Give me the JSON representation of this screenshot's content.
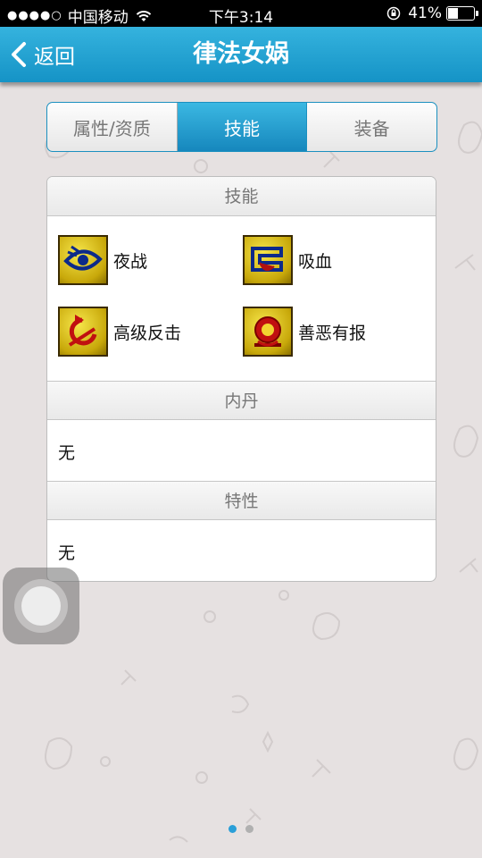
{
  "status_bar": {
    "signal": "●●●●○",
    "carrier": "中国移动",
    "time": "下午3:14",
    "battery": "41%",
    "battery_level": 0.41
  },
  "nav": {
    "back_label": "返回",
    "title": "律法女娲"
  },
  "tabs": [
    {
      "label": "属性/资质",
      "active": false
    },
    {
      "label": "技能",
      "active": true
    },
    {
      "label": "装备",
      "active": false
    }
  ],
  "skills_section": {
    "header": "技能",
    "items": [
      {
        "label": "夜战",
        "icon": "eye-icon"
      },
      {
        "label": "吸血",
        "icon": "blood-cup-icon"
      },
      {
        "label": "高级反击",
        "icon": "counter-arrow-icon"
      },
      {
        "label": "善恶有报",
        "icon": "emblem-icon"
      }
    ]
  },
  "neidan_section": {
    "header": "内丹",
    "value": "无"
  },
  "trait_section": {
    "header": "特性",
    "value": "无"
  },
  "page_indicator": {
    "count": 2,
    "current": 1
  },
  "colors": {
    "accent": "#1a9bd0",
    "background": "#e6e1e1",
    "skill_icon_gold": "#d9c21c"
  }
}
